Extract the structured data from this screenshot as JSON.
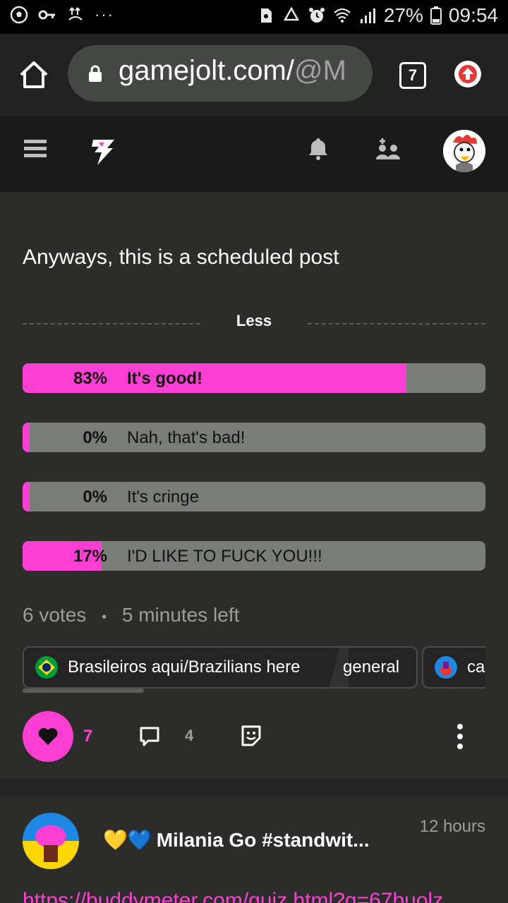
{
  "status_bar": {
    "battery": "27%",
    "time": "09:54",
    "overflow": "···"
  },
  "browser": {
    "url_domain": "gamejolt.com/",
    "url_rest": "@M",
    "tab_count": "7"
  },
  "post": {
    "text": "Anyways, this is a scheduled post",
    "less_label": "Less",
    "poll": [
      {
        "percent_label": "83%",
        "percent": 83,
        "label": "It's good!"
      },
      {
        "percent_label": "0%",
        "percent": 0,
        "label": "Nah, that's bad!"
      },
      {
        "percent_label": "0%",
        "percent": 0,
        "label": "It's cringe"
      },
      {
        "percent_label": "17%",
        "percent": 17,
        "label": "I'D LIKE TO FUCK YOU!!!"
      }
    ],
    "votes": "6 votes",
    "separator": "•",
    "time_left": "5 minutes left",
    "community": "Brasileiros aqui/Brazilians here",
    "channel": "general",
    "community2_partial": "ca",
    "like_count": "7",
    "comment_count": "4"
  },
  "next_post": {
    "author": "Milania Go #standwit...",
    "emoji": "💛💙",
    "time": "12 hours",
    "link": "https://buddymeter.com/quiz.html?q=67buolz"
  },
  "colors": {
    "accent": "#ff3fd4",
    "bar_bg": "#7a7c79",
    "page_bg": "#2c2d2b"
  }
}
